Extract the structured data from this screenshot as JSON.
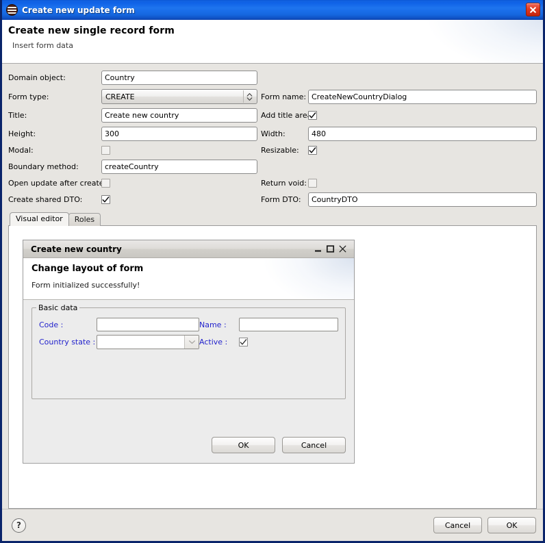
{
  "window": {
    "title": "Create new update form",
    "icon": "app-stack-icon",
    "close_label": "close-icon",
    "accent_blue": "#0a56d6",
    "close_red": "#e03b22"
  },
  "header": {
    "title": "Create new single record form",
    "subtitle": "Insert form data"
  },
  "properties": {
    "domain_object": {
      "label": "Domain object:",
      "value": "Country"
    },
    "form_type": {
      "label": "Form type:",
      "value": "CREATE",
      "stepper_icon": "up-down-stepper-icon"
    },
    "form_name": {
      "label": "Form name:",
      "value": "CreateNewCountryDialog"
    },
    "title": {
      "label": "Title:",
      "value": "Create new country"
    },
    "add_title_area": {
      "label": "Add title area:",
      "checked": true
    },
    "height": {
      "label": "Height:",
      "value": "300"
    },
    "width": {
      "label": "Width:",
      "value": "480"
    },
    "modal": {
      "label": "Modal:",
      "checked": false
    },
    "resizable": {
      "label": "Resizable:",
      "checked": true
    },
    "boundary_method": {
      "label": "Boundary method:",
      "value": "createCountry"
    },
    "open_update_after_create": {
      "label": "Open update after create:",
      "checked": false
    },
    "return_void": {
      "label": "Return void:",
      "checked": false
    },
    "create_shared_dto": {
      "label": "Create shared DTO:",
      "checked": true
    },
    "form_dto": {
      "label": "Form DTO:",
      "value": "CountryDTO"
    }
  },
  "tabs": [
    {
      "label": "Visual editor",
      "active": true
    },
    {
      "label": "Roles",
      "active": false
    }
  ],
  "preview": {
    "titlebar": {
      "title": "Create new country",
      "minimize": "minimize-icon",
      "maximize": "maximize-icon",
      "close": "close-icon"
    },
    "header": {
      "title": "Change layout of form",
      "subtitle": "Form initialized successfully!"
    },
    "group": {
      "legend": "Basic data",
      "fields": {
        "code": {
          "label": "Code :",
          "value": ""
        },
        "name": {
          "label": "Name :",
          "value": ""
        },
        "country_state": {
          "label": "Country state :",
          "value": "",
          "arrow_icon": "chevron-down-icon"
        },
        "active": {
          "label": "Active :",
          "checked": true
        }
      },
      "label_color": "#2222cc"
    },
    "buttons": {
      "ok": "OK",
      "cancel": "Cancel"
    }
  },
  "footer": {
    "help_icon": "question-mark-icon",
    "help_glyph": "?",
    "cancel": "Cancel",
    "ok": "OK"
  }
}
